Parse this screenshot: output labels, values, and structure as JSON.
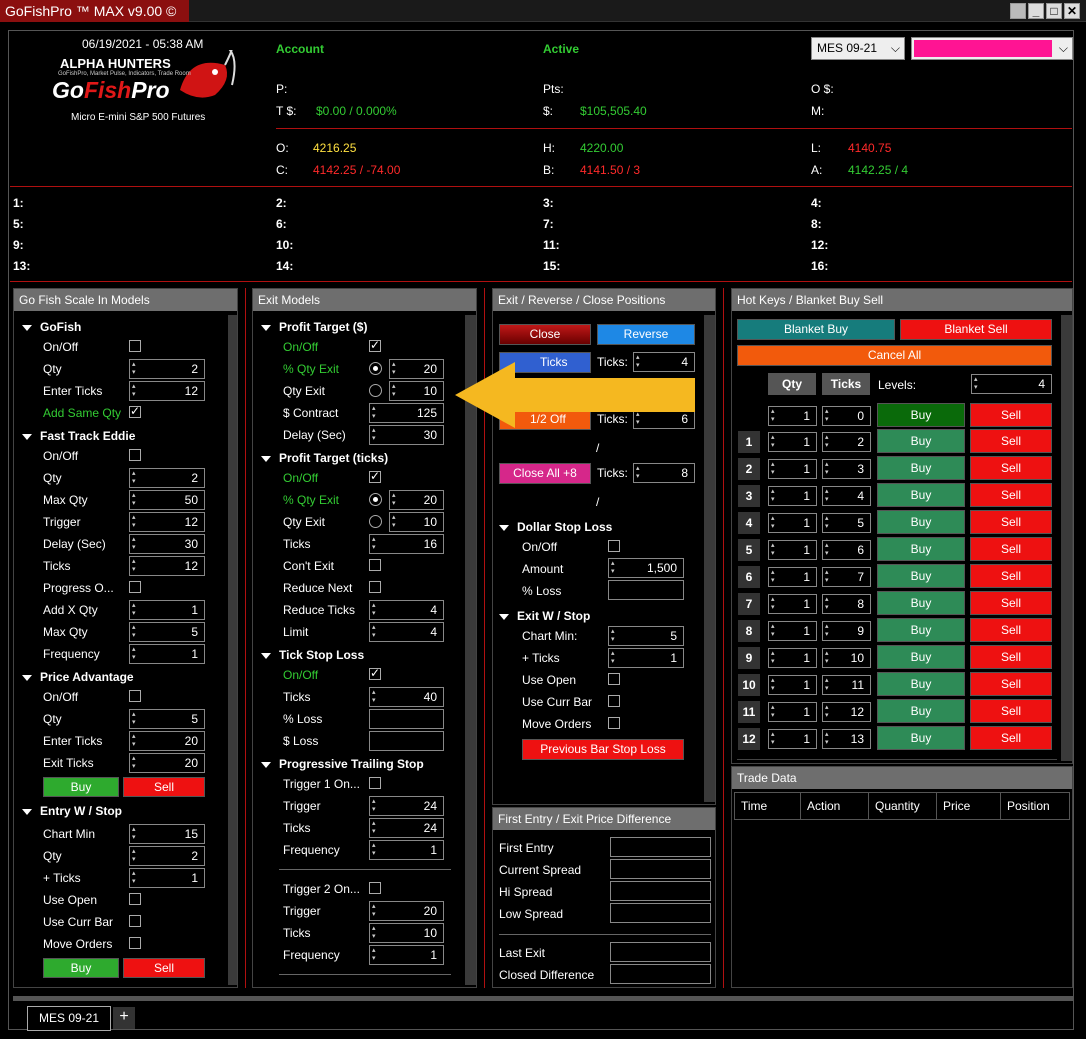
{
  "window": {
    "title": "GoFishPro ™ MAX v9.00 ©"
  },
  "header": {
    "datetime": "06/19/2021 - 05:38 AM",
    "logo_top": "ALPHA HUNTERS",
    "logo_sub": "GoFishPro, Market Pulse, Indicators, Trade Room",
    "logo_main_a": "Go",
    "logo_main_b": "Fish",
    "logo_main_c": "Pro",
    "product": "Micro E-mini S&P 500 Futures",
    "account_label": "Account",
    "active_label": "Active",
    "instrument": "MES 09-21",
    "account_color": "#ff1493",
    "p_label": "P:",
    "pts_label": "Pts:",
    "os_label": "O $:",
    "t_label": "T $:",
    "t_value": "$0.00 / 0.000%",
    "dollar_label": "$:",
    "dollar_value": "$105,505.40",
    "m_label": "M:",
    "o_label": "O:",
    "o_value": "4216.25",
    "h_label": "H:",
    "h_value": "4220.00",
    "l_label": "L:",
    "l_value": "4140.75",
    "c_label": "C:",
    "c_value": "4142.25 / -74.00",
    "b_label": "B:",
    "b_value": "4141.50 / 3",
    "a_label": "A:",
    "a_value": "4142.25 / 4"
  },
  "slots": [
    "1:",
    "2:",
    "3:",
    "4:",
    "5:",
    "6:",
    "7:",
    "8:",
    "9:",
    "10:",
    "11:",
    "12:",
    "13:",
    "14:",
    "15:",
    "16:"
  ],
  "scale": {
    "title": "Go Fish Scale In Models",
    "gofish": "GoFish",
    "onoff": "On/Off",
    "qty": "Qty",
    "qty_v": "2",
    "enter_ticks": "Enter Ticks",
    "enter_ticks_v": "12",
    "add_same": "Add Same Qty",
    "fte": "Fast Track Eddie",
    "fte_onoff": "On/Off",
    "fte_qty": "Qty",
    "fte_qty_v": "2",
    "fte_maxqty": "Max Qty",
    "fte_maxqty_v": "50",
    "fte_trigger": "Trigger",
    "fte_trigger_v": "12",
    "fte_delay": "Delay (Sec)",
    "fte_delay_v": "30",
    "fte_ticks": "Ticks",
    "fte_ticks_v": "12",
    "fte_prog": "Progress O...",
    "fte_addx": "Add X Qty",
    "fte_addx_v": "1",
    "fte_maxq2": "Max Qty",
    "fte_maxq2_v": "5",
    "fte_freq": "Frequency",
    "fte_freq_v": "1",
    "pa": "Price Advantage",
    "pa_onoff": "On/Off",
    "pa_qty": "Qty",
    "pa_qty_v": "5",
    "pa_enter": "Enter Ticks",
    "pa_enter_v": "20",
    "pa_exit": "Exit Ticks",
    "pa_exit_v": "20",
    "buy": "Buy",
    "sell": "Sell",
    "ews": "Entry W / Stop",
    "ews_chart": "Chart Min",
    "ews_chart_v": "15",
    "ews_qty": "Qty",
    "ews_qty_v": "2",
    "ews_ticks": "+ Ticks",
    "ews_ticks_v": "1",
    "ews_open": "Use Open",
    "ews_curr": "Use Curr Bar",
    "ews_move": "Move Orders"
  },
  "exit": {
    "title": "Exit Models",
    "pt": "Profit Target ($)",
    "pt_onoff": "On/Off",
    "pt_pct": "% Qty Exit",
    "pt_pct_v": "20",
    "pt_qty": "Qty Exit",
    "pt_qty_v": "10",
    "pt_contract": "$ Contract",
    "pt_contract_v": "125",
    "pt_delay": "Delay (Sec)",
    "pt_delay_v": "30",
    "ptt": "Profit Target (ticks)",
    "ptt_onoff": "On/Off",
    "ptt_pct": "% Qty Exit",
    "ptt_pct_v": "20",
    "ptt_qty": "Qty Exit",
    "ptt_qty_v": "10",
    "ptt_ticks": "Ticks",
    "ptt_ticks_v": "16",
    "ptt_cont": "Con't Exit",
    "ptt_reduce": "Reduce Next",
    "ptt_reduce_ticks": "Reduce Ticks",
    "ptt_reduce_ticks_v": "4",
    "ptt_limit": "Limit",
    "ptt_limit_v": "4",
    "tsl": "Tick Stop Loss",
    "tsl_onoff": "On/Off",
    "tsl_ticks": "Ticks",
    "tsl_ticks_v": "40",
    "tsl_pct": "% Loss",
    "tsl_dollar": "$ Loss",
    "pts": "Progressive Trailing Stop",
    "t1": "Trigger 1 On...",
    "t1_trigger": "Trigger",
    "t1_trigger_v": "24",
    "t1_ticks": "Ticks",
    "t1_ticks_v": "24",
    "t1_freq": "Frequency",
    "t1_freq_v": "1",
    "t2": "Trigger 2 On...",
    "t2_trigger": "Trigger",
    "t2_trigger_v": "20",
    "t2_ticks": "Ticks",
    "t2_ticks_v": "10",
    "t2_freq": "Frequency",
    "t2_freq_v": "1"
  },
  "erc": {
    "title": "Exit / Reverse / Close Positions",
    "close": "Close",
    "reverse": "Reverse",
    "btn_ticks": "Ticks",
    "ticks_lbl": "Ticks:",
    "ticks1_v": "4",
    "half_off": "1/2 Off",
    "ticks2_v": "6",
    "slash": "/",
    "close_all": "Close All +8",
    "ticks3_v": "8",
    "dsl": "Dollar Stop Loss",
    "dsl_onoff": "On/Off",
    "dsl_amount": "Amount",
    "dsl_amount_v": "1,500",
    "dsl_pct": "% Loss",
    "ews": "Exit W / Stop",
    "ews_chart": "Chart Min:",
    "ews_chart_v": "5",
    "ews_ticks": "+ Ticks",
    "ews_ticks_v": "1",
    "ews_open": "Use Open",
    "ews_curr": "Use Curr Bar",
    "ews_move": "Move Orders",
    "prev_bar": "Previous Bar Stop Loss"
  },
  "diff": {
    "title": "First Entry / Exit Price Difference",
    "first_entry": "First Entry",
    "current_spread": "Current Spread",
    "hi_spread": "Hi Spread",
    "low_spread": "Low Spread",
    "last_exit": "Last Exit",
    "closed_diff": "Closed Difference"
  },
  "hotkeys": {
    "title": "Hot Keys / Blanket Buy Sell",
    "blanket_buy": "Blanket Buy",
    "blanket_sell": "Blanket Sell",
    "cancel_all": "Cancel All",
    "qty_hdr": "Qty",
    "ticks_hdr": "Ticks",
    "levels_lbl": "Levels:",
    "levels_v": "4",
    "buy": "Buy",
    "sell": "Sell",
    "rows": [
      {
        "n": "",
        "qty": "1",
        "ticks": "0"
      },
      {
        "n": "1",
        "qty": "1",
        "ticks": "2"
      },
      {
        "n": "2",
        "qty": "1",
        "ticks": "3"
      },
      {
        "n": "3",
        "qty": "1",
        "ticks": "4"
      },
      {
        "n": "4",
        "qty": "1",
        "ticks": "5"
      },
      {
        "n": "5",
        "qty": "1",
        "ticks": "6"
      },
      {
        "n": "6",
        "qty": "1",
        "ticks": "7"
      },
      {
        "n": "7",
        "qty": "1",
        "ticks": "8"
      },
      {
        "n": "8",
        "qty": "1",
        "ticks": "9"
      },
      {
        "n": "9",
        "qty": "1",
        "ticks": "10"
      },
      {
        "n": "10",
        "qty": "1",
        "ticks": "11"
      },
      {
        "n": "11",
        "qty": "1",
        "ticks": "12"
      },
      {
        "n": "12",
        "qty": "1",
        "ticks": "13"
      }
    ]
  },
  "trade": {
    "title": "Trade Data",
    "columns": [
      "Time",
      "Action",
      "Quantity",
      "Price",
      "Position"
    ]
  },
  "tabs": {
    "active": "MES 09-21",
    "add": "+"
  }
}
